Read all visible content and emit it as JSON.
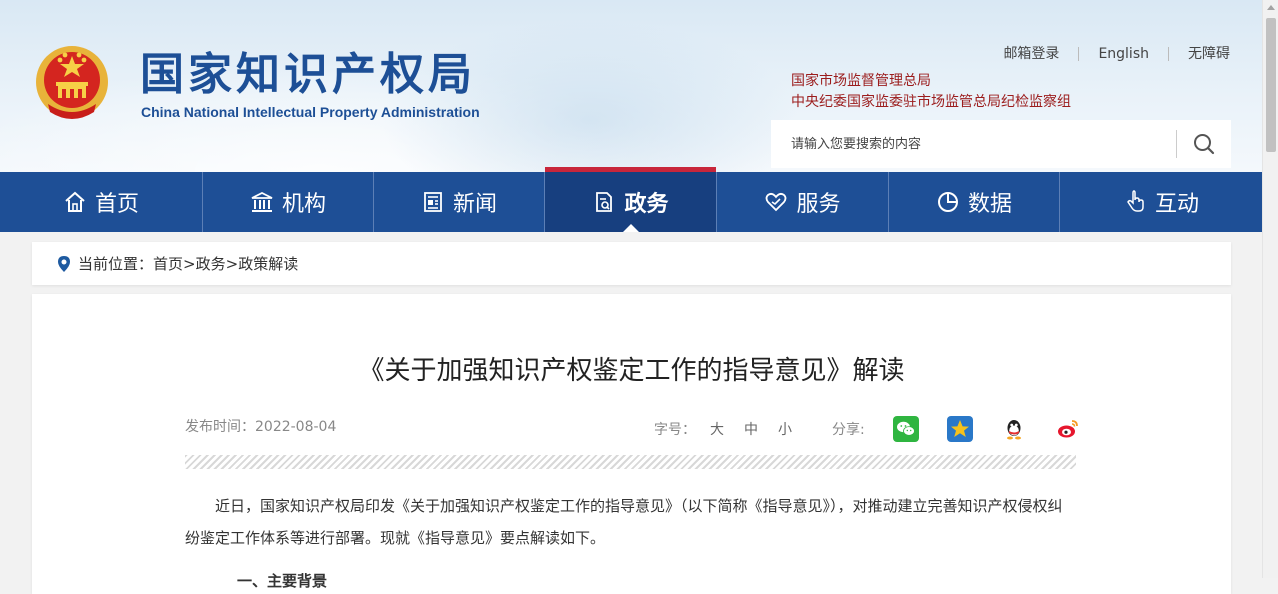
{
  "header": {
    "title": "国家知识产权局",
    "subtitle": "China National Intellectual Property Administration",
    "top_links": [
      "邮箱登录",
      "English",
      "无障碍"
    ],
    "org_line_1": "国家市场监督管理总局",
    "org_line_2": "中央纪委国家监委驻市场监管总局纪检监察组",
    "search_placeholder": "请输入您要搜索的内容"
  },
  "nav": {
    "items": [
      {
        "label": "首页",
        "icon": "home-icon"
      },
      {
        "label": "机构",
        "icon": "institution-icon"
      },
      {
        "label": "新闻",
        "icon": "news-icon"
      },
      {
        "label": "政务",
        "icon": "government-affairs-icon",
        "active": true
      },
      {
        "label": "服务",
        "icon": "service-icon"
      },
      {
        "label": "数据",
        "icon": "data-icon"
      },
      {
        "label": "互动",
        "icon": "interaction-icon"
      }
    ],
    "active_index": 3
  },
  "breadcrumb": {
    "prefix": "当前位置：",
    "items": [
      "首页",
      "政务",
      "政策解读"
    ],
    "separator": ">"
  },
  "article": {
    "title": "《关于加强知识产权鉴定工作的指导意见》解读",
    "publish_time": "发布时间：2022-08-04",
    "font_size_label": "字号：",
    "font_sizes": [
      "大",
      "中",
      "小"
    ],
    "share_label": "分享:",
    "share_icons": [
      "wechat-icon",
      "qzone-icon",
      "qq-icon",
      "weibo-icon"
    ],
    "paragraph_1": "近日，国家知识产权局印发《关于加强知识产权鉴定工作的指导意见》（以下简称《指导意见》），对推动建立完善知识产权侵权纠纷鉴定工作体系等进行部署。现就《指导意见》要点解读如下。",
    "paragraph_2": "一、主要背景"
  },
  "colors": {
    "nav_blue": "#1e4f96",
    "nav_active": "#173f7f",
    "title_blue": "#1d4f96",
    "org_red": "#9b1c1c",
    "active_bar_red": "#c8263b"
  }
}
